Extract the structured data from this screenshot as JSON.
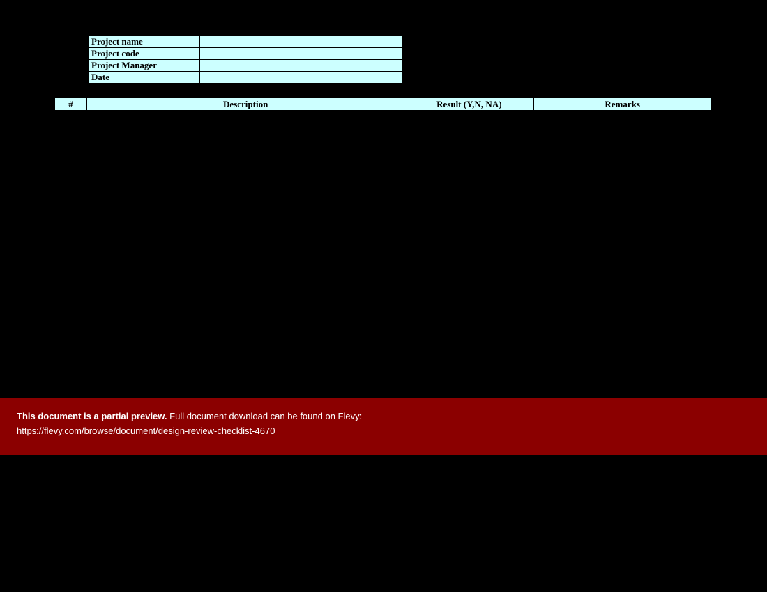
{
  "projectInfo": {
    "labels": {
      "name": "Project name",
      "code": "Project code",
      "manager": "Project Manager",
      "date": "Date"
    },
    "values": {
      "name": "",
      "code": "",
      "manager": "",
      "date": ""
    }
  },
  "checklistHeaders": {
    "num": "#",
    "description": "Description",
    "result": "Result (Y,N, NA)",
    "remarks": "Remarks"
  },
  "banner": {
    "boldText": "This document is a partial preview.",
    "restText": "  Full document download can be found on Flevy:",
    "link": "https://flevy.com/browse/document/design-review-checklist-4670"
  }
}
